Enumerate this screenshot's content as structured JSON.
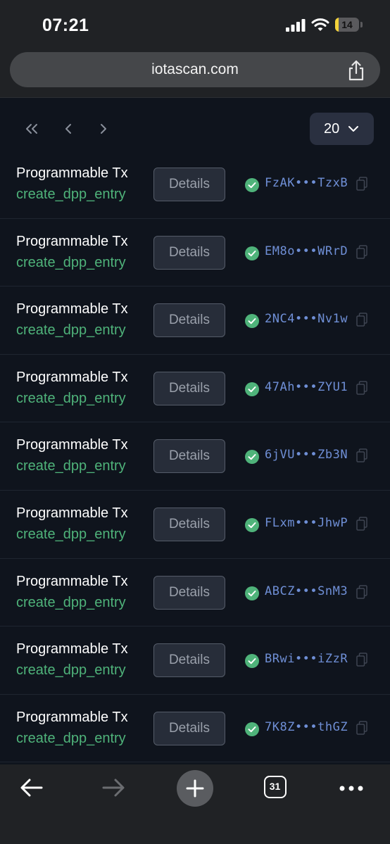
{
  "status_bar": {
    "time": "07:21",
    "battery": "14",
    "battery_level": 0.14
  },
  "browser": {
    "url": "iotascan.com",
    "tab_count": "31"
  },
  "pagination": {
    "page_size": "20"
  },
  "transactions": [
    {
      "type": "Programmable Tx",
      "function": "create_dpp_entry",
      "action": "Details",
      "digest": "FzAK•••TzxB",
      "status": "success"
    },
    {
      "type": "Programmable Tx",
      "function": "create_dpp_entry",
      "action": "Details",
      "digest": "EM8o•••WRrD",
      "status": "success"
    },
    {
      "type": "Programmable Tx",
      "function": "create_dpp_entry",
      "action": "Details",
      "digest": "2NC4•••Nv1w",
      "status": "success"
    },
    {
      "type": "Programmable Tx",
      "function": "create_dpp_entry",
      "action": "Details",
      "digest": "47Ah•••ZYU1",
      "status": "success"
    },
    {
      "type": "Programmable Tx",
      "function": "create_dpp_entry",
      "action": "Details",
      "digest": "6jVU•••Zb3N",
      "status": "success"
    },
    {
      "type": "Programmable Tx",
      "function": "create_dpp_entry",
      "action": "Details",
      "digest": "FLxm•••JhwP",
      "status": "success"
    },
    {
      "type": "Programmable Tx",
      "function": "create_dpp_entry",
      "action": "Details",
      "digest": "ABCZ•••SnM3",
      "status": "success"
    },
    {
      "type": "Programmable Tx",
      "function": "create_dpp_entry",
      "action": "Details",
      "digest": "BRwi•••iZzR",
      "status": "success"
    },
    {
      "type": "Programmable Tx",
      "function": "create_dpp_entry",
      "action": "Details",
      "digest": "7K8Z•••thGZ",
      "status": "success"
    }
  ],
  "colors": {
    "background": "#0f141d",
    "function_text": "#4fb37a",
    "digest_text": "#6f8fd6",
    "success": "#4fb37a",
    "battery_low": "#f5d33a"
  },
  "icons": {
    "first_page": "double-chevron-left-icon",
    "prev_page": "chevron-left-icon",
    "next_page": "chevron-right-icon",
    "dropdown": "chevron-down-icon",
    "status": "check-circle-icon",
    "copy": "copy-icon",
    "share": "share-icon",
    "back": "arrow-left-icon",
    "forward": "arrow-right-icon",
    "new_tab": "plus-icon",
    "more": "ellipsis-icon"
  }
}
